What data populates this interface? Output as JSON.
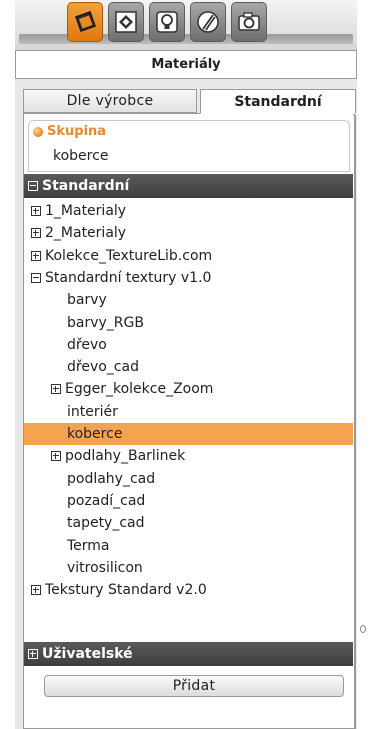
{
  "toolbar": {
    "tools": [
      {
        "icon": "material-icon",
        "active": true
      },
      {
        "icon": "shape-icon",
        "active": false
      },
      {
        "icon": "light-bulb-icon",
        "active": false
      },
      {
        "icon": "sphere-icon",
        "active": false
      },
      {
        "icon": "camera-icon",
        "active": false
      }
    ]
  },
  "header": {
    "title": "Materiály"
  },
  "tabs": [
    {
      "label": "Dle výrobce",
      "active": false
    },
    {
      "label": "Standardní",
      "active": true
    }
  ],
  "group": {
    "label": "Skupina",
    "value": "koberce"
  },
  "sections": {
    "standard": {
      "label": "Standardní"
    },
    "user": {
      "label": "Uživatelské"
    }
  },
  "tree": [
    {
      "label": "1_Materialy",
      "expander": "plus"
    },
    {
      "label": "2_Materialy",
      "expander": "plus"
    },
    {
      "label": "Kolekce_TextureLib.com",
      "expander": "plus"
    },
    {
      "label": "Standardní textury v1.0",
      "expander": "minus"
    },
    {
      "label": "barvy",
      "expander": ""
    },
    {
      "label": "barvy_RGB",
      "expander": ""
    },
    {
      "label": "dřevo",
      "expander": ""
    },
    {
      "label": "dřevo_cad",
      "expander": ""
    },
    {
      "label": "Egger_kolekce_Zoom",
      "expander": "plus"
    },
    {
      "label": "interiér",
      "expander": ""
    },
    {
      "label": "koberce",
      "expander": "",
      "selected": true
    },
    {
      "label": "podlahy_Barlinek",
      "expander": "plus"
    },
    {
      "label": "podlahy_cad",
      "expander": ""
    },
    {
      "label": "pozadí_cad",
      "expander": ""
    },
    {
      "label": "tapety_cad",
      "expander": ""
    },
    {
      "label": "Terma",
      "expander": ""
    },
    {
      "label": "vitrosilicon",
      "expander": ""
    },
    {
      "label": "Tekstury Standard v2.0",
      "expander": "plus"
    }
  ],
  "add_button": {
    "label": "Přidat"
  },
  "colors": {
    "accent": "#f4a451",
    "section_header": "#4a4a4a",
    "group_label": "#e88a2a"
  }
}
